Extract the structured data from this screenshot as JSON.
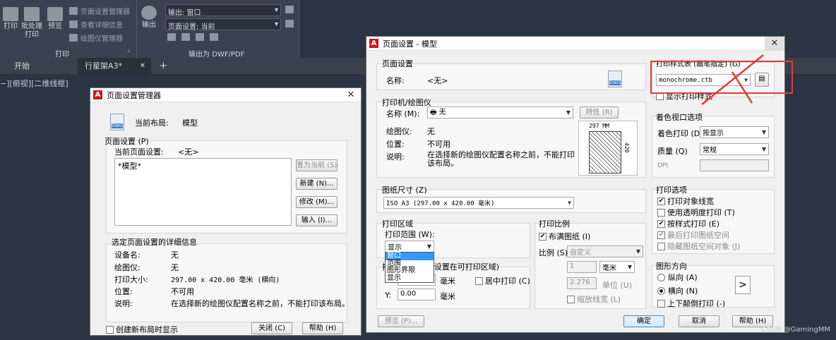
{
  "ribbon": {
    "plot": "打印",
    "batch_plot": "批处理\n打印",
    "preview": "预览",
    "page_setup_manager": "页面设置管理器",
    "view_details": "查看详细信息",
    "plotter_manager": "绘图仪管理器",
    "plot_group": "打印",
    "output": "输出",
    "output_dropdown": "输出: 窗口",
    "page_setup_dropdown": "页面设置: 当前",
    "export_group": "输出为 DWF/PDF"
  },
  "tabs": {
    "start": "开始",
    "drawing": "行星架A3*",
    "close": "✕",
    "add": "+"
  },
  "viewport_label": "−][俯视][二维线框]",
  "psm": {
    "title": "页面设置管理器",
    "current_layout_label": "当前布局:",
    "current_layout_value": "模型",
    "page_setups_group": "页面设置 (P)",
    "current_page_setup_label": "当前页面设置:",
    "current_page_setup_value": "<无>",
    "list_item": "*模型*",
    "set_current": "置为当前 (S)",
    "new": "新建 (N)...",
    "modify": "修改 (M)...",
    "import": "输入 (I)...",
    "details_group": "选定页面设置的详细信息",
    "device_label": "设备名:",
    "device_value": "无",
    "plotter_label": "绘图仪:",
    "plotter_value": "无",
    "size_label": "打印大小:",
    "size_value": "297.00 x 420.00 毫米 (横向)",
    "where_label": "位置:",
    "where_value": "不可用",
    "desc_label": "说明:",
    "desc_value": "在选择新的绘图仪配置名称之前，不能打印该布局。",
    "show_on_new": "创建新布局时显示",
    "close": "关闭 (C)",
    "help": "帮助 (H)",
    "dwg": "DWG"
  },
  "ps": {
    "title": "页面设置 - 模型",
    "page_setup_group": "页面设置",
    "name_label": "名称:",
    "name_value": "<无>",
    "printer_group": "打印机/绘图仪",
    "printer_name_label": "名称 (M):",
    "printer_name_value": "无",
    "properties": "特性 (R)",
    "plotter_label": "绘图仪:",
    "plotter_value": "无",
    "where_label": "位置:",
    "where_value": "不可用",
    "desc_label": "说明:",
    "desc_value": "在选择新的绘图仪配置名称之前，不能打印该布局。",
    "preview_width": "297 MM",
    "preview_height": "420",
    "paper_group": "图纸尺寸 (Z)",
    "paper_value": "ISO A3 (297.00 x 420.00 毫米)",
    "area_group": "打印区域",
    "what_label": "打印范围 (W):",
    "what_value": "显示",
    "what_options": [
      "窗口",
      "范围",
      "图形界限",
      "显示"
    ],
    "offset_group": "打印偏移 (原点设置在可打印区域)",
    "offset_x_label": "X:",
    "offset_unit": "毫米",
    "center": "居中打印 (C)",
    "offset_y_label": "Y:",
    "offset_y_value": "0.00",
    "scale_group": "打印比例",
    "fit_paper": "布满图纸 (I)",
    "scale_label": "比例 (S):",
    "scale_value": "自定义",
    "scale_num": "1",
    "scale_unit": "毫米",
    "scale_den": "2.276",
    "scale_den_unit": "单位 (U)",
    "scale_lw": "缩放线宽 (L)",
    "preview_btn": "预览 (P)...",
    "ok": "确定",
    "cancel": "取消",
    "help": "帮助 (H)",
    "pen_group": "打印样式表 (画笔指定) (G)",
    "pen_value": "monochrome.ctb",
    "show_styles": "显示打印样式",
    "shaded_group": "着色视口选项",
    "shade_label": "着色打印 (D)",
    "shade_value": "按显示",
    "quality_label": "质量 (Q)",
    "quality_value": "常规",
    "dpi_label": "DPI",
    "options_group": "打印选项",
    "opt1": "打印对象线宽",
    "opt2": "使用透明度打印 (T)",
    "opt3": "按样式打印 (E)",
    "opt4": "最后打印图纸空间",
    "opt5": "隐藏图纸空间对象 (J)",
    "orient_group": "图形方向",
    "portrait": "纵向 (A)",
    "landscape": "横向 (N)",
    "upside": "上下颠倒打印 (-)",
    "dwg": "DWG",
    "close": "✕"
  },
  "watermark": "CSDN @GamingMM"
}
